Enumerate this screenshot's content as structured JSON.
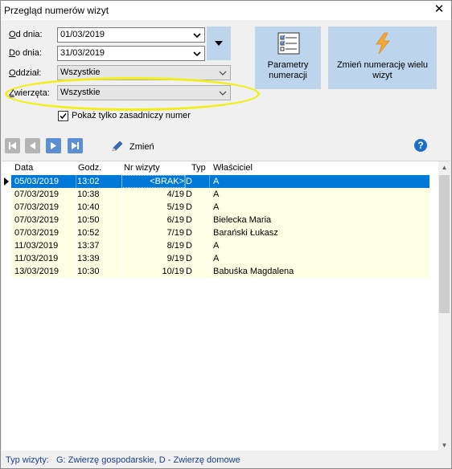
{
  "window": {
    "title": "Przegląd numerów wizyt",
    "close_glyph": "✕"
  },
  "filters": {
    "od_dnia": {
      "label_hot": "O",
      "label_rest": "d dnia:",
      "value": "01/03/2019"
    },
    "do_dnia": {
      "label_hot": "D",
      "label_rest": "o dnia:",
      "value": "31/03/2019"
    },
    "oddzial": {
      "label_hot": "O",
      "label_rest": "ddział:",
      "value": "Wszystkie"
    },
    "zwierzeta": {
      "label_hot": "Z",
      "label_rest": "wierzęta:",
      "value": "Wszystkie"
    },
    "tylko_zasadniczy": {
      "label": "Pokaż tylko zasadniczy numer",
      "checked": true
    }
  },
  "buttons": {
    "parametry": {
      "line1": "Parametry",
      "line2": "numeracji",
      "icon": "checklist-icon"
    },
    "zmien_wielu": {
      "line1": "Zmień numerację wielu",
      "line2": "wizyt",
      "icon": "lightning-icon"
    }
  },
  "toolbar": {
    "zmien_label": "Zmień",
    "help_glyph": "?"
  },
  "table": {
    "columns": [
      "Data",
      "Godz.",
      "Nr wizyty",
      "Typ",
      "Właściciel"
    ],
    "rows": [
      {
        "data": "05/03/2019",
        "godz": "13:02",
        "nr": "<BRAK>",
        "typ": "D",
        "wlasciciel": "A"
      },
      {
        "data": "07/03/2019",
        "godz": "10:38",
        "nr": "4/19",
        "typ": "D",
        "wlasciciel": "A"
      },
      {
        "data": "07/03/2019",
        "godz": "10:40",
        "nr": "5/19",
        "typ": "D",
        "wlasciciel": "A"
      },
      {
        "data": "07/03/2019",
        "godz": "10:50",
        "nr": "6/19",
        "typ": "D",
        "wlasciciel": "Bielecka Maria"
      },
      {
        "data": "07/03/2019",
        "godz": "10:52",
        "nr": "7/19",
        "typ": "D",
        "wlasciciel": "Barański Łukasz"
      },
      {
        "data": "11/03/2019",
        "godz": "13:37",
        "nr": "8/19",
        "typ": "D",
        "wlasciciel": "A"
      },
      {
        "data": "11/03/2019",
        "godz": "13:39",
        "nr": "9/19",
        "typ": "D",
        "wlasciciel": "A"
      },
      {
        "data": "13/03/2019",
        "godz": "10:30",
        "nr": "10/19",
        "typ": "D",
        "wlasciciel": "Babuśka  Magdalena"
      }
    ]
  },
  "footer": {
    "label": "Typ wizyty:",
    "legend": "G: Zwierzę gospodarskie, D - Zwierzę domowe"
  },
  "colors": {
    "selection": "#0078d7",
    "row_bg": "#fefee5",
    "button_bg": "#bcd4ec",
    "highlight_ellipse": "#f2ee17",
    "help_blue": "#1a6fc9"
  }
}
